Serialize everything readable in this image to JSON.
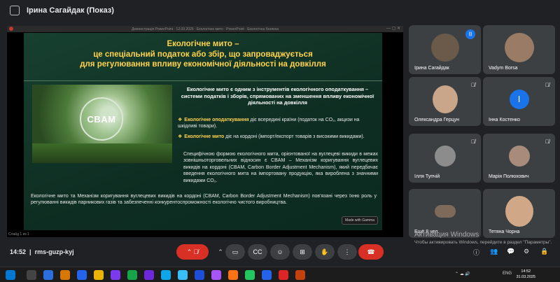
{
  "meeting": {
    "presenter_label": "Ірина Сагайдак (Показ)",
    "chrome_title": "Демонстрація PowerPoint · 12.03.2025 · Екологічне мито · PowerPoint · Екологічна безпека",
    "code": "rms-guzp-kyj",
    "time": "14:52"
  },
  "slide": {
    "title": [
      "Екологічне мито –",
      "це спеціальний податок або збір, що запроваджується",
      "для регулювання впливу економічної діяльності на довкілля"
    ],
    "image_label": "CBAM",
    "intro": "Екологічне мито є одним з інструментів екологічного оподаткування – системи податків і зборів, спрямованих на зменшення впливу економічної діяльності на довкілля",
    "b1_term": "Екологічне оподаткування",
    "b1_text": "діє всередині країни (податок на CO₂, акцизи на шкідливі товари).",
    "b2_term": "Екологічне мито",
    "b2_text": "діє на кордоні (імпорт/експорт товарів з високими викидами).",
    "para": "Специфічною формою екологічного мита, орієнтованої на вуглецеві викиди в межах зовнішньоторговельних відносин є CBAM – Механізм коригування вуглецевих викидів на кордоні (CBAM, Carbon Border Adjustment Mechanism), який передбачає введення екологічного мита на імпортовану продукцію, яка вироблена з значними викидами CO₂.",
    "bottom": "Екологічне мито та Механізм коригування вуглецевих викидів на кордоні (CBAM, Carbon Border Adjustment Mechanism) пов'язані через їхню роль у регулюванні викидів парникових газів та забезпеченні конкурентоспроможності екологічно чистого виробництва.",
    "badge": "Made with Gamma",
    "page": "Слайд 1 из 1"
  },
  "participants": [
    {
      "name": "Ірина Сагайдак"
    },
    {
      "name": "Vadym Borsa"
    },
    {
      "name": "Олександра Герцун"
    },
    {
      "name": "Інна Костенко",
      "initial": "І"
    },
    {
      "name": "Ілля Тупчій"
    },
    {
      "name": "Марія Полюхович"
    },
    {
      "name": "Ещё 8 чел."
    },
    {
      "name": "Тетяна Чорна"
    }
  ],
  "watermark": {
    "line1": "Активация Windows",
    "line2": "Чтобы активировать Windows, перейдите в раздел \"Параметры\"."
  },
  "tray": {
    "lang": "ENG",
    "time": "14:52",
    "date": "31.03.2025"
  },
  "colors": {
    "accent": "#ffd34a",
    "danger": "#d93025",
    "bg": "#202124",
    "slide": "#17402f"
  }
}
